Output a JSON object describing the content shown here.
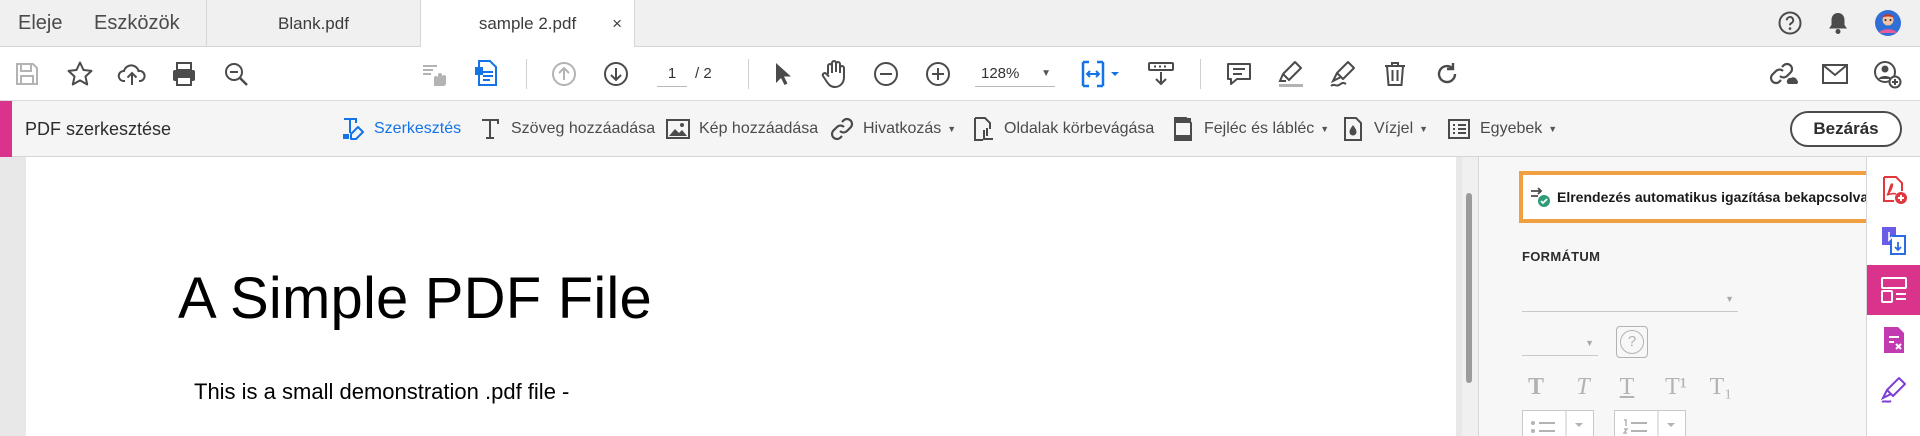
{
  "menu": {
    "home": "Eleje",
    "tools": "Eszközök"
  },
  "tabs": [
    {
      "label": "Blank.pdf",
      "active": false
    },
    {
      "label": "sample 2.pdf",
      "active": true
    }
  ],
  "tab_close_glyph": "×",
  "topbar_icons": [
    "help-icon",
    "notifications-icon",
    "avatar"
  ],
  "toolbar": {
    "page_current": "1",
    "page_total": "/ 2",
    "zoom": "128%",
    "zoom_caret": "▼",
    "icons": [
      "save-icon",
      "bookmark-star-icon",
      "upload-cloud-icon",
      "print-icon",
      "search-zoom-icon",
      "touch-mode-icon",
      "pdf-edit-icon",
      "prev-page-icon",
      "next-page-icon",
      "select-cursor-icon",
      "hand-tool-icon",
      "zoom-out-icon",
      "zoom-in-icon",
      "fit-page-icon",
      "scroll-mode-icon",
      "comment-icon",
      "highlight-icon",
      "sign-icon",
      "delete-icon",
      "rotate-icon",
      "share-link-icon",
      "email-icon",
      "add-user-icon"
    ]
  },
  "editbar": {
    "title": "PDF szerkesztése",
    "tools": {
      "edit": "Szerkesztés",
      "add_text": "Szöveg hozzáadása",
      "add_image": "Kép hozzáadása",
      "link": "Hivatkozás",
      "crop": "Oldalak körbevágása",
      "header_footer": "Fejléc és lábléc",
      "watermark": "Vízjel",
      "more": "Egyebek"
    },
    "dropdown_caret": "▼",
    "close_label": "Bezárás"
  },
  "document": {
    "title": "A Simple PDF File",
    "body_line": "This is a small demonstration .pdf file -"
  },
  "right_panel": {
    "auto_layout_label": "Elrendezés automatikus igazítása bekapcsolva",
    "format_heading": "FORMÁTUM",
    "help_glyph": "?",
    "caret": "▼",
    "format_glyphs": [
      "T",
      "T",
      "T",
      "T¹",
      "T₁"
    ]
  },
  "colors": {
    "accent_pink": "#d9338b",
    "accent_blue": "#1473e6",
    "highlight_orange": "#f0a040"
  }
}
